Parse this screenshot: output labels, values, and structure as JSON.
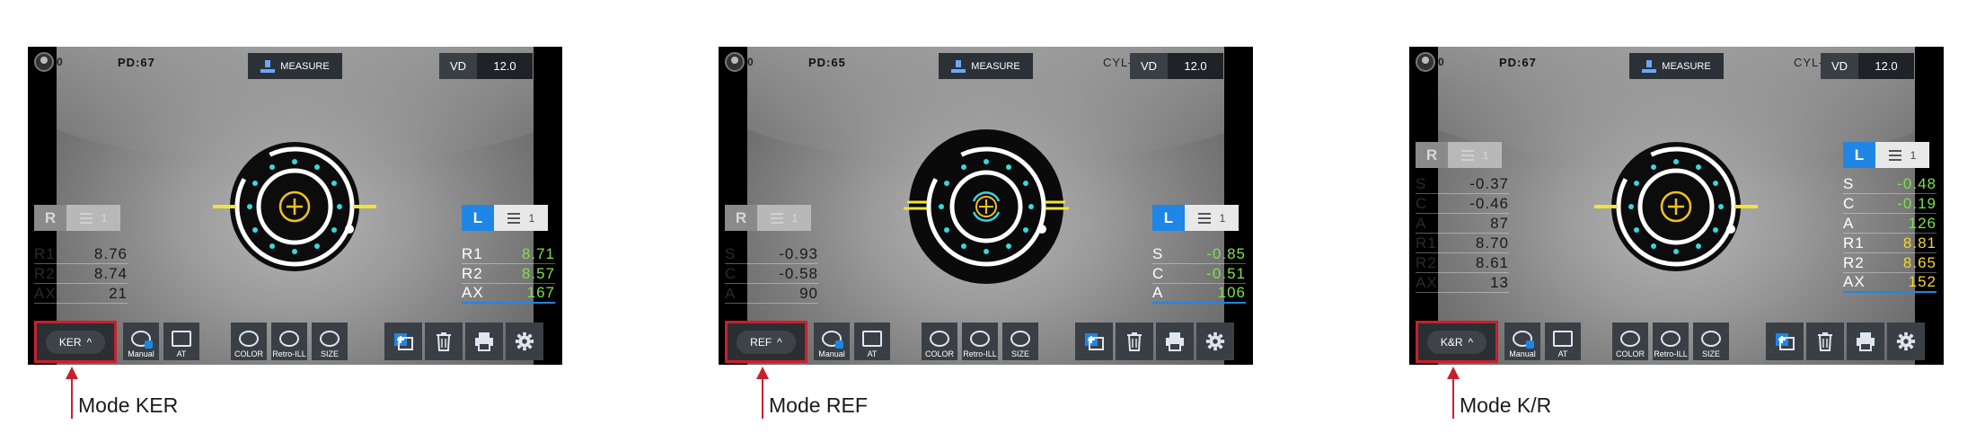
{
  "panels": [
    {
      "id": "ker",
      "user_num": "0",
      "pd": "PD:67",
      "measure_label": "MEASURE",
      "cyl": "",
      "vd_label": "VD",
      "vd_value": "12.0",
      "left_tab": {
        "letter": "R",
        "count": "1"
      },
      "right_tab": {
        "letter": "L",
        "count": "1"
      },
      "left_rows": [
        {
          "k": "R1",
          "v": "8.76"
        },
        {
          "k": "R2",
          "v": "8.74"
        },
        {
          "k": "AX",
          "v": "21"
        }
      ],
      "right_rows": [
        {
          "k": "R1",
          "v": "8.71",
          "c": "green"
        },
        {
          "k": "R2",
          "v": "8.57",
          "c": "green"
        },
        {
          "k": "AX",
          "v": "167",
          "c": "green"
        }
      ],
      "mode_label": "KER",
      "caption": "Mode KER"
    },
    {
      "id": "ref",
      "user_num": "0",
      "pd": "PD:65",
      "measure_label": "MEASURE",
      "cyl": "CYL–",
      "vd_label": "VD",
      "vd_value": "12.0",
      "left_tab": {
        "letter": "R",
        "count": "1"
      },
      "right_tab": {
        "letter": "L",
        "count": "1"
      },
      "left_rows": [
        {
          "k": "S",
          "v": "-0.93"
        },
        {
          "k": "C",
          "v": "-0.58"
        },
        {
          "k": "A",
          "v": "90"
        }
      ],
      "right_rows": [
        {
          "k": "S",
          "v": "-0.85",
          "c": "green"
        },
        {
          "k": "C",
          "v": "-0.51",
          "c": "green"
        },
        {
          "k": "A",
          "v": "106",
          "c": "green"
        }
      ],
      "mode_label": "REF",
      "caption": "Mode REF"
    },
    {
      "id": "kr",
      "user_num": "0",
      "pd": "PD:67",
      "measure_label": "MEASURE",
      "cyl": "CYL–",
      "vd_label": "VD",
      "vd_value": "12.0",
      "left_tab": {
        "letter": "R",
        "count": "1"
      },
      "right_tab": {
        "letter": "L",
        "count": "1"
      },
      "left_rows": [
        {
          "k": "S",
          "v": "-0.37"
        },
        {
          "k": "C",
          "v": "-0.46"
        },
        {
          "k": "A",
          "v": "87"
        },
        {
          "k": "R1",
          "v": "8.70"
        },
        {
          "k": "R2",
          "v": "8.61"
        },
        {
          "k": "AX",
          "v": "13"
        }
      ],
      "right_rows": [
        {
          "k": "S",
          "v": "-0.48",
          "c": "green"
        },
        {
          "k": "C",
          "v": "-0.19",
          "c": "green"
        },
        {
          "k": "A",
          "v": "126",
          "c": "green"
        },
        {
          "k": "R1",
          "v": "8.81",
          "c": "yellow"
        },
        {
          "k": "R2",
          "v": "8.65",
          "c": "yellow"
        },
        {
          "k": "AX",
          "v": "152",
          "c": "yellow"
        }
      ],
      "mode_label": "K&R",
      "caption": "Mode K/R"
    }
  ],
  "tools": {
    "manual": "Manual",
    "at": "AT",
    "color": "COLOR",
    "retro": "Retro-ILL",
    "size": "SIZE"
  },
  "colors": {
    "accent_blue": "#1f86e6",
    "highlight_red": "#c8202e",
    "value_green": "#7fe04a",
    "value_yellow": "#f5d629",
    "target_yellow": "#f2c21b",
    "dot_cyan": "#38d6e0"
  }
}
